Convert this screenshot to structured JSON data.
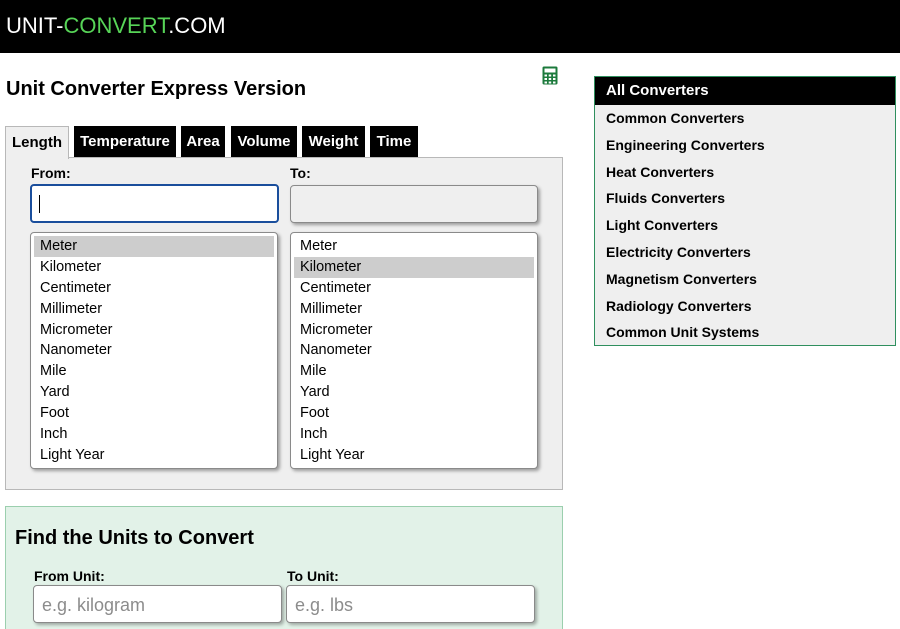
{
  "header": {
    "logo_prefix": "UNIT-",
    "logo_highlight": "CONVERT",
    "logo_suffix": ".COM",
    "accent_color": "#57d457"
  },
  "page_title": "Unit Converter Express Version",
  "calculator_icon": "calculator-icon",
  "tabs": [
    {
      "label": "Length",
      "active": true
    },
    {
      "label": "Temperature",
      "active": false
    },
    {
      "label": "Area",
      "active": false
    },
    {
      "label": "Volume",
      "active": false
    },
    {
      "label": "Weight",
      "active": false
    },
    {
      "label": "Time",
      "active": false
    }
  ],
  "converter": {
    "from_label": "From:",
    "to_label": "To:",
    "from_value": "",
    "to_value": "",
    "from_units": [
      "Meter",
      "Kilometer",
      "Centimeter",
      "Millimeter",
      "Micrometer",
      "Nanometer",
      "Mile",
      "Yard",
      "Foot",
      "Inch",
      "Light Year"
    ],
    "from_selected": "Meter",
    "to_units": [
      "Meter",
      "Kilometer",
      "Centimeter",
      "Millimeter",
      "Micrometer",
      "Nanometer",
      "Mile",
      "Yard",
      "Foot",
      "Inch",
      "Light Year"
    ],
    "to_selected": "Kilometer"
  },
  "sidebar": {
    "heading": "All Converters",
    "items": [
      "Common Converters",
      "Engineering Converters",
      "Heat Converters",
      "Fluids Converters",
      "Light Converters",
      "Electricity Converters",
      "Magnetism Converters",
      "Radiology Converters",
      "Common Unit Systems"
    ]
  },
  "find": {
    "title": "Find the Units to Convert",
    "from_label": "From Unit:",
    "from_placeholder": "e.g. kilogram",
    "to_label": "To Unit:",
    "to_placeholder": "e.g. lbs"
  }
}
